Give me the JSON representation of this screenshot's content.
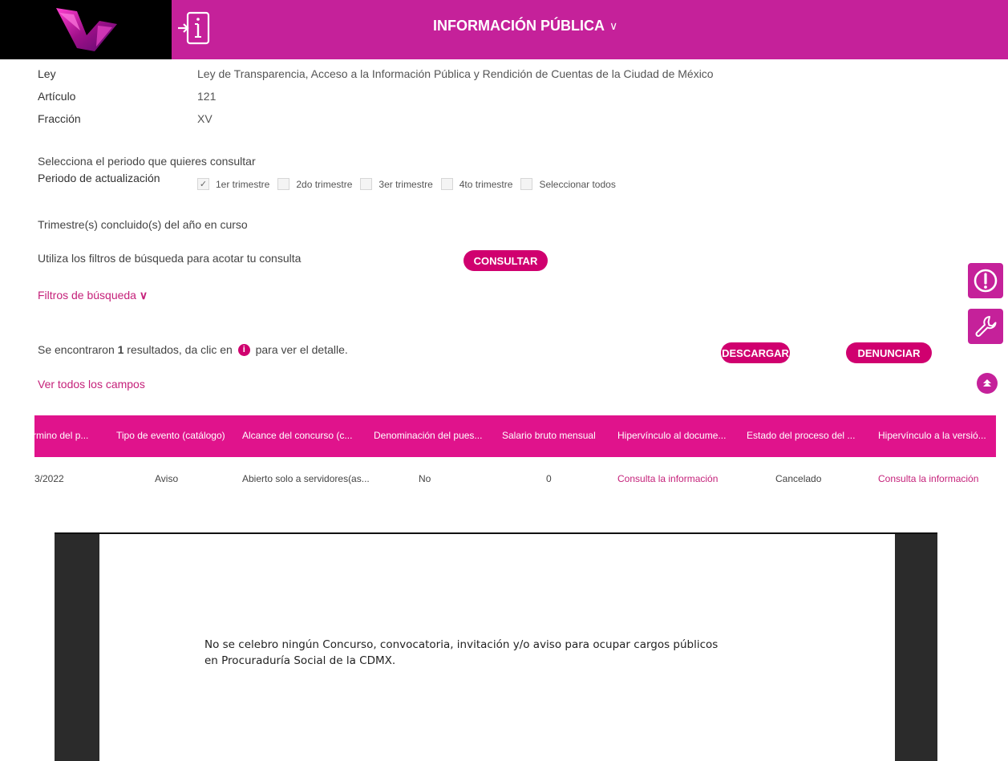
{
  "header": {
    "title": "INFORMACIÓN PÚBLICA",
    "chevron": "∨"
  },
  "info": {
    "ley_label": "Ley",
    "ley_value": "Ley de Transparencia, Acceso a la Información Pública y Rendición de Cuentas de la Ciudad de México",
    "articulo_label": "Artículo",
    "articulo_value": "121",
    "fraccion_label": "Fracción",
    "fraccion_value": "XV"
  },
  "period": {
    "prompt": "Selecciona el periodo que quieres consultar",
    "label": "Periodo de actualización",
    "options": [
      {
        "label": "1er trimestre",
        "checked": true
      },
      {
        "label": "2do trimestre",
        "checked": false
      },
      {
        "label": "3er trimestre",
        "checked": false
      },
      {
        "label": "4to trimestre",
        "checked": false
      },
      {
        "label": "Seleccionar todos",
        "checked": false
      }
    ],
    "note": "Trimestre(s) concluido(s) del año en curso"
  },
  "filters": {
    "hint": "Utiliza los filtros de búsqueda para acotar tu consulta",
    "consult_button": "CONSULTAR",
    "toggle": "Filtros de búsqueda",
    "toggle_icon": "∨"
  },
  "results": {
    "prefix": "Se encontraron ",
    "count": "1",
    "middle": " resultados, da clic en ",
    "suffix": " para ver el detalle.",
    "download_button": "DESCARGAR",
    "report_button": "DENUNCIAR",
    "view_all_link": "Ver todos los campos"
  },
  "table": {
    "headers": [
      "rmino del p...",
      "Tipo de evento (catálogo)",
      "Alcance del concurso (c...",
      "Denominación del pues...",
      "Salario bruto mensual",
      "Hipervínculo al docume...",
      "Estado del proceso del ...",
      "Hipervínculo a la versió..."
    ],
    "row": [
      "3/2022",
      "Aviso",
      "Abierto solo a servidores(as...",
      "No",
      "0",
      "Consulta la información",
      "Cancelado",
      "Consulta la información"
    ]
  },
  "document": {
    "line1": "No se celebro ningún Concurso, convocatoria, invitación y/o aviso para ocupar cargos públicos",
    "line2": "en Procuraduría Social de la CDMX."
  },
  "colors": {
    "brand": "#c5219a",
    "accent": "#d0006f",
    "table_header": "#e0138c"
  }
}
